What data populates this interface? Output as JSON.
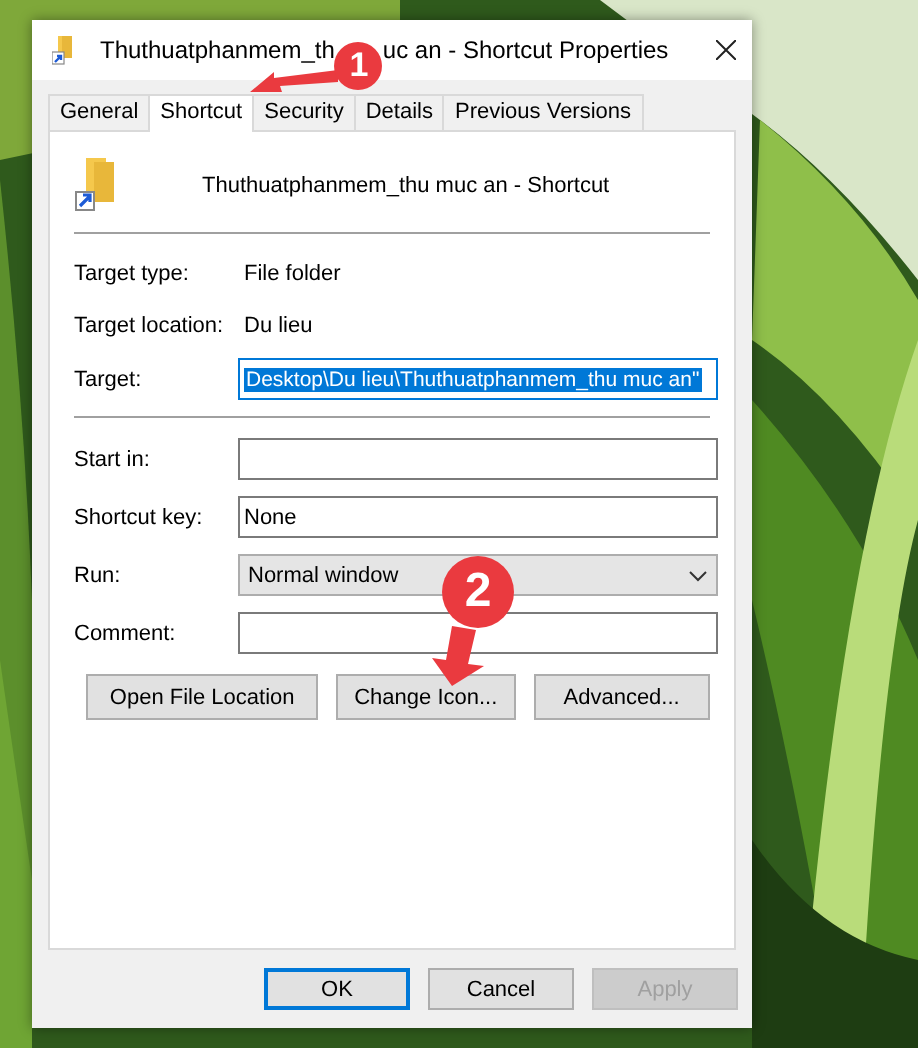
{
  "window": {
    "title_parts": [
      "Thuthuatphanmem_th",
      "uc an - Shortcut Properties"
    ]
  },
  "tabs": [
    {
      "label": "General",
      "selected": false
    },
    {
      "label": "Shortcut",
      "selected": true
    },
    {
      "label": "Security",
      "selected": false
    },
    {
      "label": "Details",
      "selected": false
    },
    {
      "label": "Previous Versions",
      "selected": false
    }
  ],
  "shortcut": {
    "name": "Thuthuatphanmem_thu muc an - Shortcut"
  },
  "details": [
    {
      "kind": "info",
      "label": "Target type:",
      "value": "File folder"
    },
    {
      "kind": "info",
      "label": "Target location:",
      "value": "Du lieu"
    },
    {
      "kind": "text",
      "label": "Target:",
      "value": "Desktop\\Du lieu\\Thuthuatphanmem_thu muc an\"",
      "selected": true
    }
  ],
  "settings": [
    {
      "kind": "text",
      "label": "Start in:",
      "selected": false
    },
    {
      "kind": "text",
      "label": "Shortcut key:",
      "value": "None",
      "selected": false
    },
    {
      "kind": "dropdown",
      "label": "Run:",
      "value": "Normal window"
    },
    {
      "kind": "text",
      "label": "Comment:",
      "selected": false
    }
  ],
  "actions": [
    "Open File Location",
    "Change Icon...",
    "Advanced..."
  ],
  "buttons": [
    {
      "label": "OK",
      "default": true,
      "disabled": false
    },
    {
      "label": "Cancel",
      "default": false,
      "disabled": false
    },
    {
      "label": "Apply",
      "default": false,
      "disabled": true
    }
  ],
  "annotations": [
    {
      "label": "1"
    },
    {
      "label": "2"
    }
  ]
}
